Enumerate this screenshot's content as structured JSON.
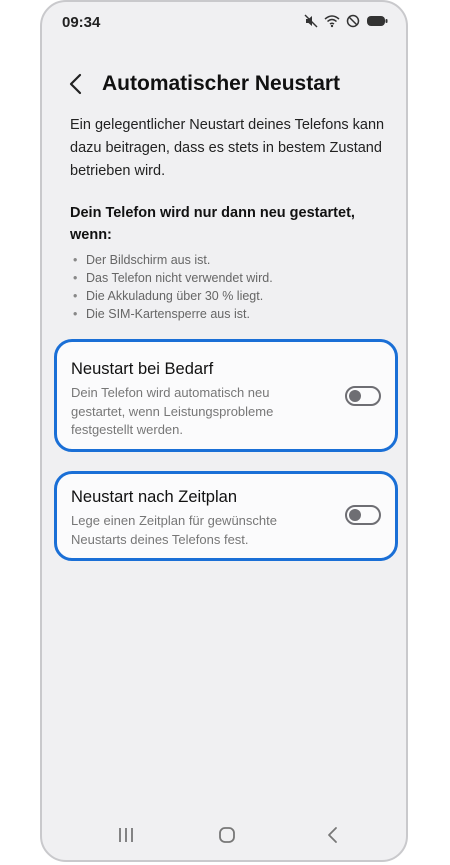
{
  "status_bar": {
    "time": "09:34",
    "icons": [
      "mute-icon",
      "wifi-icon",
      "do-not-disturb-icon",
      "battery-icon"
    ]
  },
  "header": {
    "title": "Automatischer Neustart",
    "back_icon": "chevron-left-icon"
  },
  "intro_text": "Ein gelegentlicher Neustart deines Telefons kann dazu beitragen, dass es stets in bestem Zustand betrieben wird.",
  "conditions": {
    "title": "Dein Telefon wird nur dann neu gestartet, wenn:",
    "items": [
      "Der Bildschirm aus ist.",
      "Das Telefon nicht verwendet wird.",
      "Die Akkuladung über 30 % liegt.",
      "Die SIM-Kartensperre aus ist."
    ]
  },
  "settings": [
    {
      "title": "Neustart bei Bedarf",
      "description": "Dein Telefon wird automatisch neu gestartet, wenn Leistungsprobleme festgestellt werden.",
      "enabled": false
    },
    {
      "title": "Neustart nach Zeitplan",
      "description": "Lege einen Zeitplan für gewünschte Neustarts deines Telefons fest.",
      "enabled": false
    }
  ],
  "nav_bar": {
    "icons": [
      "recents-icon",
      "home-icon",
      "back-icon"
    ]
  },
  "colors": {
    "highlight": "#1a6fd6",
    "background": "#f0f0f2",
    "toggle_off": "#6e6e73"
  }
}
